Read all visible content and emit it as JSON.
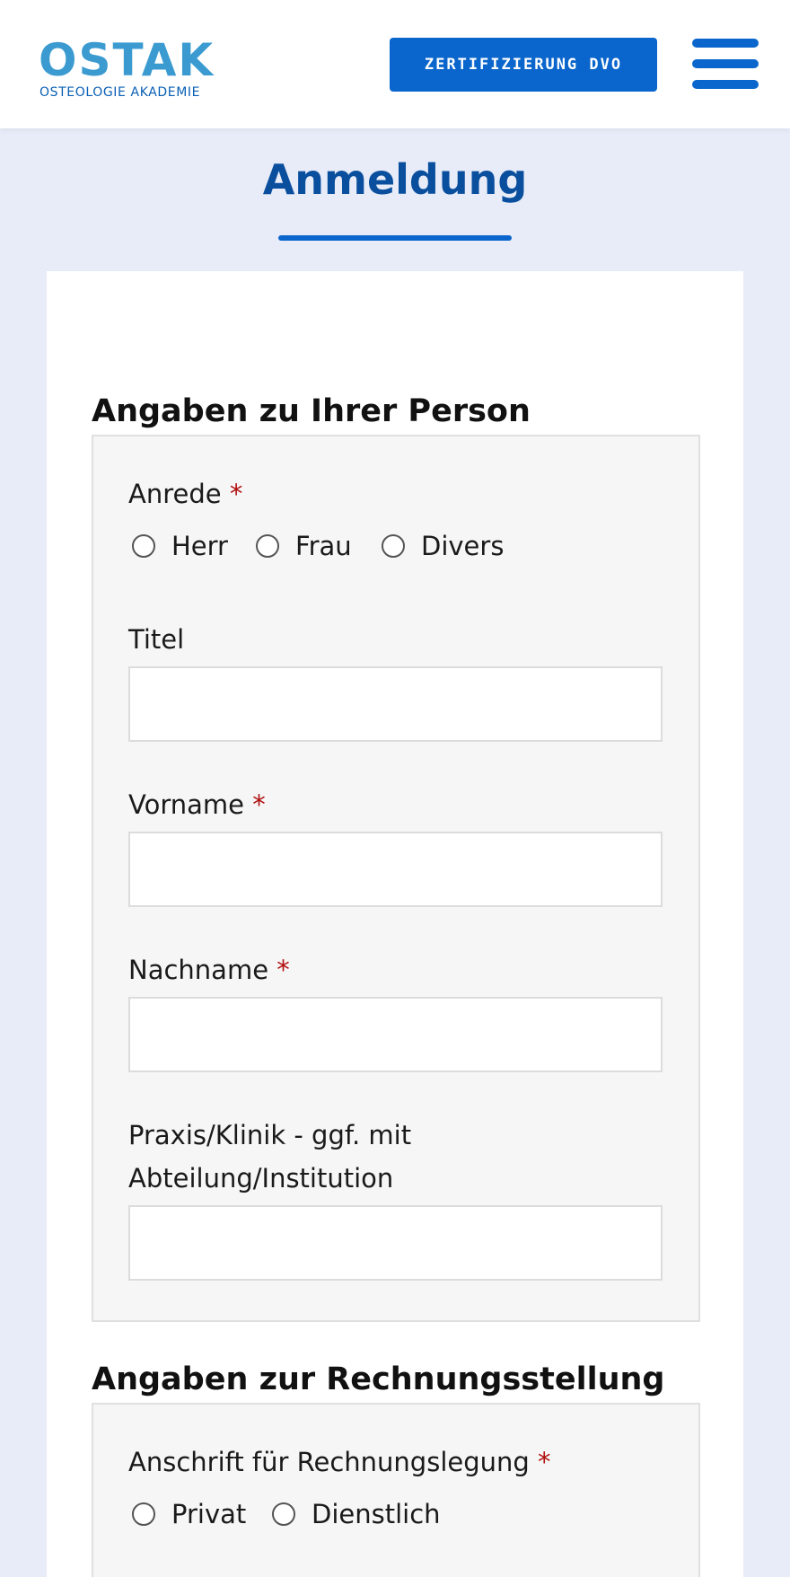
{
  "header": {
    "logo_word": "OSTAK",
    "logo_sub": "OSTEOLOGIE AKADEMIE",
    "cta_label": "ZERTIFIZIERUNG DVO",
    "menu_icon": "hamburger-menu-icon"
  },
  "page": {
    "title": "Anmeldung"
  },
  "section_person": {
    "heading": "Angaben zu Ihrer Person",
    "anrede": {
      "label": "Anrede",
      "required_mark": "*",
      "options": [
        "Herr",
        "Frau",
        "Divers"
      ]
    },
    "titel": {
      "label": "Titel",
      "value": ""
    },
    "vorname": {
      "label": "Vorname",
      "required_mark": "*",
      "value": ""
    },
    "nachname": {
      "label": "Nachname",
      "required_mark": "*",
      "value": ""
    },
    "praxis": {
      "label_line1": "Praxis/Klinik - ggf. mit",
      "label_line2": "Abteilung/Institution",
      "value": ""
    }
  },
  "section_billing": {
    "heading": "Angaben zur Rechnungsstellung",
    "anschrift": {
      "label": "Anschrift für Rechnungslegung",
      "required_mark": "*",
      "options": [
        "Privat",
        "Dienstlich"
      ]
    }
  },
  "colors": {
    "primary": "#0a66cc",
    "title": "#0a4f9e",
    "page_background": "#e8ecf9",
    "required": "#b10f0f",
    "logo_light": "#3b9bd1"
  }
}
